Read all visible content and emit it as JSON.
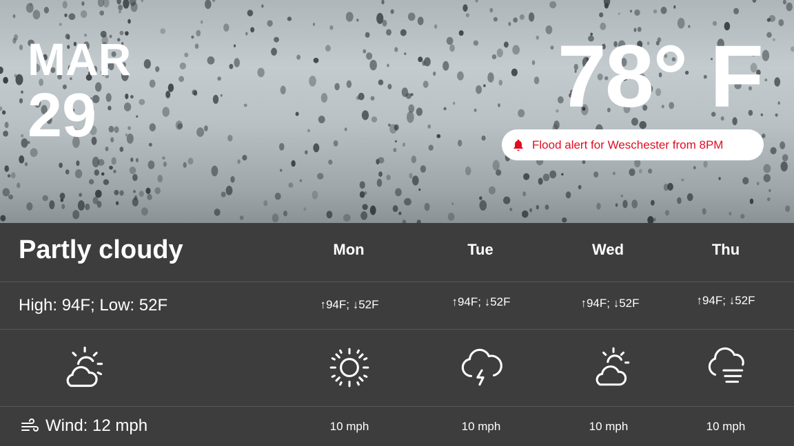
{
  "header": {
    "month": "MAR",
    "day": "29",
    "temperature": "78° F",
    "alert": {
      "text": "Flood alert for Weschester from 8PM",
      "icon": "bell-icon",
      "color": "#e00d22"
    }
  },
  "current": {
    "condition": "Partly cloudy",
    "high_low": "High: 94F; Low: 52F",
    "icon": "partly-cloudy-icon",
    "wind": "Wind: 12 mph"
  },
  "forecast": [
    {
      "day": "Mon",
      "high_low": "↑94F; ↓52F",
      "icon": "sun-icon",
      "wind": "10 mph"
    },
    {
      "day": "Tue",
      "high_low": "↑94F; ↓52F",
      "icon": "thunderstorm-icon",
      "wind": "10 mph"
    },
    {
      "day": "Wed",
      "high_low": "↑94F; ↓52F",
      "icon": "partly-cloudy-icon",
      "wind": "10 mph"
    },
    {
      "day": "Thu",
      "high_low": "↑94F; ↓52F",
      "icon": "fog-icon",
      "wind": "10 mph"
    }
  ]
}
